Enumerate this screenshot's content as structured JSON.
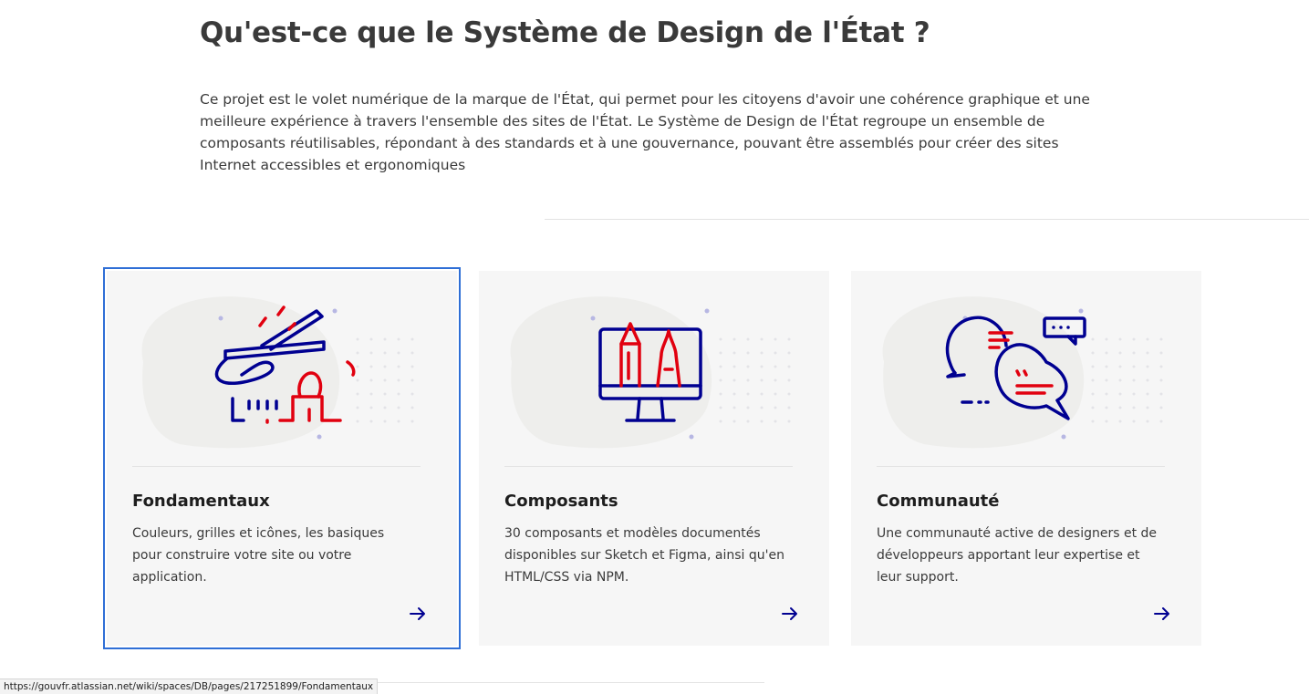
{
  "page": {
    "title": "Qu'est-ce que le Système de Design de l'État ?",
    "intro": "Ce projet est le volet numérique de la marque de l'État, qui permet pour les citoyens d'avoir une cohérence graphique et une meilleure expérience à travers l'ensemble des sites de l'État. Le Système de Design de l'État regroupe un ensemble de composants réutilisables, répondant à des standards et à une gouvernance, pouvant être assemblés pour créer des sites Internet accessibles et ergonomiques"
  },
  "cards": [
    {
      "title": "Fondamentaux",
      "description": "Couleurs, grilles et icônes, les basiques pour construire votre site ou votre application.",
      "icon": "paint-tools-icon",
      "arrow_icon": "arrow-right-icon"
    },
    {
      "title": "Composants",
      "description": "30 composants et modèles documentés disponibles sur Sketch et Figma, ainsi qu'en HTML/CSS via NPM.",
      "icon": "monitor-design-icon",
      "arrow_icon": "arrow-right-icon"
    },
    {
      "title": "Communauté",
      "description": "Une communauté active de designers et de développeurs apportant leur expertise et leur support.",
      "icon": "chat-bubbles-icon",
      "arrow_icon": "arrow-right-icon"
    }
  ],
  "status_bar": {
    "url": "https://gouvfr.atlassian.net/wiki/spaces/DB/pages/217251899/Fondamentaux"
  },
  "colors": {
    "blue_france": "#000091",
    "red_marianne": "#e1000f",
    "card_background": "#f6f6f6",
    "focus_outline": "#2f6fd6"
  }
}
